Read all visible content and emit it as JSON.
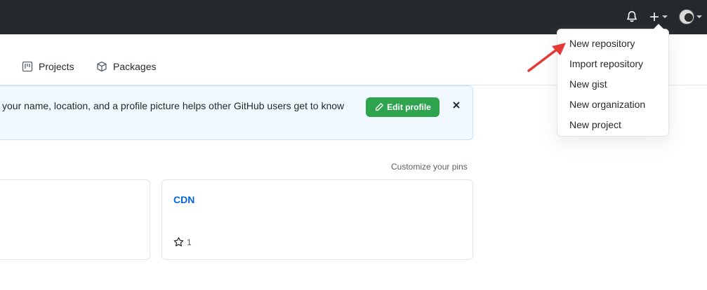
{
  "header": {
    "icons": {
      "notifications": "bell-icon",
      "create": "plus-icon",
      "avatar": "avatar"
    }
  },
  "nav": {
    "tabs": [
      {
        "label": "Projects",
        "icon": "project-board-icon"
      },
      {
        "label": "Packages",
        "icon": "package-icon"
      }
    ]
  },
  "banner": {
    "text": "your name, location, and a profile picture helps other GitHub users get to know",
    "edit_label": "Edit profile"
  },
  "pins": {
    "customize_label": "Customize your pins",
    "cards": [
      {
        "title": "",
        "stars": ""
      },
      {
        "title": "CDN",
        "stars": "1"
      }
    ]
  },
  "dropdown": {
    "items": [
      "New repository",
      "Import repository",
      "New gist",
      "New organization",
      "New project"
    ]
  },
  "colors": {
    "topbar": "#24292e",
    "primary_button": "#2ea44f",
    "link": "#0366d6",
    "banner_bg": "#f1f8ff",
    "annotation_arrow": "#e53935"
  }
}
